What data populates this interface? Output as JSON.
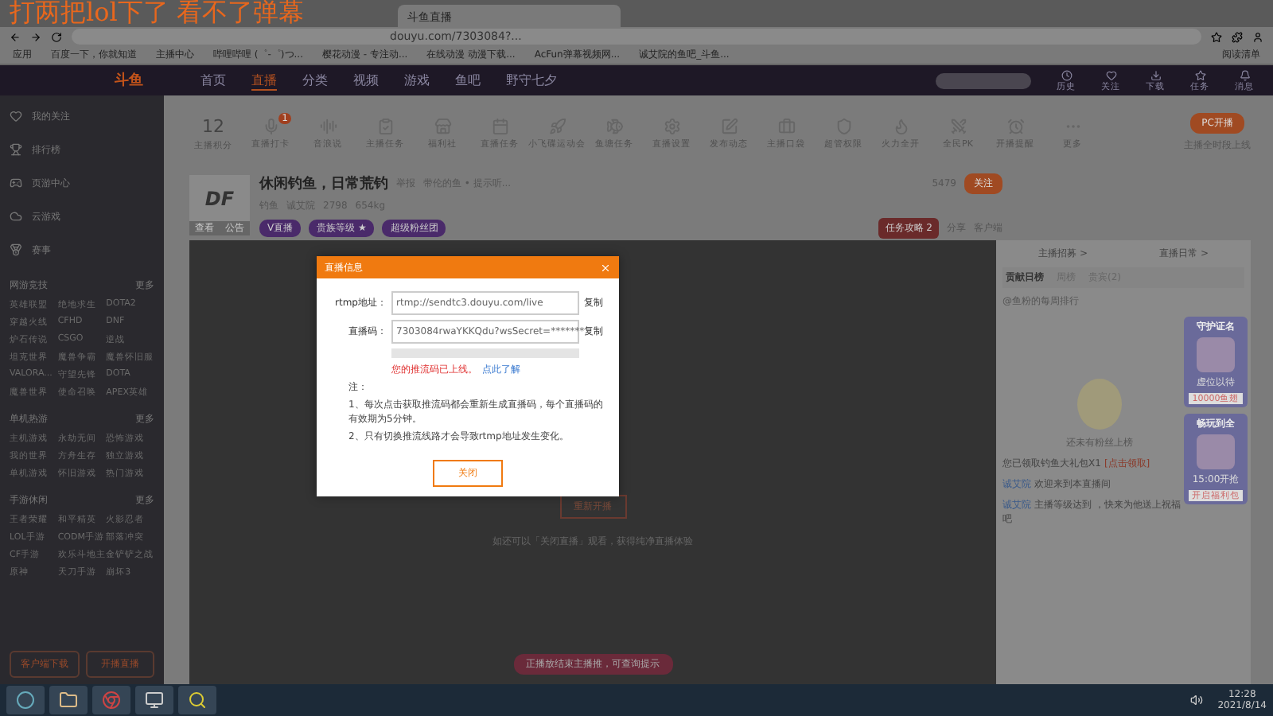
{
  "caption": "打两把lol下了 看不了弹幕",
  "browser": {
    "tab_title": "斗鱼直播",
    "url": "douyu.com/7303084?...",
    "bookmarks": [
      "应用",
      "百度一下，你就知道",
      "主播中心",
      "哔哩哔哩 (゜-゜)つ...",
      "樱花动漫 - 专注动...",
      "在线动漫 动漫下载...",
      "AcFun弹幕视频网...",
      "诚艾院的鱼吧_斗鱼..."
    ],
    "reading_list": "阅读清单"
  },
  "site_nav": {
    "logo": "斗鱼",
    "items": [
      {
        "label": "首页",
        "selected": false
      },
      {
        "label": "直播",
        "selected": true
      },
      {
        "label": "分类",
        "selected": false
      },
      {
        "label": "视频",
        "selected": false
      },
      {
        "label": "游戏",
        "selected": false
      },
      {
        "label": "鱼吧",
        "selected": false
      },
      {
        "label": "野守七夕",
        "selected": false
      }
    ],
    "actions": [
      "历史",
      "关注",
      "下载",
      "任务",
      "消息"
    ]
  },
  "sidebar": {
    "items": [
      "我的关注",
      "排行榜",
      "页游中心",
      "云游戏",
      "赛事"
    ],
    "sections": [
      {
        "title": "网游竞技",
        "more": "更多",
        "games": [
          "英雄联盟",
          "绝地求生",
          "DOTA2",
          "穿越火线",
          "CFHD",
          "DNF",
          "炉石传说",
          "CSGO",
          "逆战",
          "坦克世界",
          "魔兽争霸",
          "魔兽怀旧服",
          "VALORA...",
          "守望先锋",
          "DOTA",
          "魔兽世界",
          "使命召唤",
          "APEX英雄"
        ]
      },
      {
        "title": "单机热游",
        "more": "更多",
        "games": [
          "主机游戏",
          "永劫无间",
          "恐怖游戏",
          "我的世界",
          "方舟生存",
          "独立游戏",
          "单机游戏",
          "怀旧游戏",
          "热门游戏"
        ]
      },
      {
        "title": "手游休闲",
        "more": "更多",
        "games": [
          "王者荣耀",
          "和平精英",
          "火影忍者",
          "LOL手游",
          "CODM手游",
          "部落冲突",
          "CF手游",
          "欢乐斗地主",
          "金铲铲之战",
          "原神",
          "天刀手游",
          "崩坏3"
        ]
      }
    ],
    "buttons": [
      "客户端下载",
      "开播直播"
    ]
  },
  "toolbar": {
    "score": "12",
    "score_label": "主播积分",
    "items": [
      {
        "label": "直播打卡",
        "badge": "1"
      },
      {
        "label": "音浪说"
      },
      {
        "label": "主播任务"
      },
      {
        "label": "福利社"
      },
      {
        "label": "直播任务"
      },
      {
        "label": "小飞碟运动会"
      },
      {
        "label": "鱼塘任务"
      },
      {
        "label": "直播设置"
      },
      {
        "label": "发布动态"
      },
      {
        "label": "主播口袋"
      },
      {
        "label": "超管权限"
      },
      {
        "label": "火力全开"
      },
      {
        "label": "全民PK"
      },
      {
        "label": "开播提醒"
      },
      {
        "label": "更多"
      }
    ],
    "pc_button": "PC开播",
    "pc_note": "主播全时段上线"
  },
  "room": {
    "avatar": "DF",
    "avatar_links": [
      "查看",
      "公告"
    ],
    "title": "休闲钓鱼，日常荒钓",
    "report": "举报",
    "notice": "带伦的鱼 • 提示听...",
    "category": "钓鱼",
    "anchor": "诚艾院",
    "hot": "2798",
    "weight": "654kg",
    "tags": [
      "V直播",
      "贵族等级 ★",
      "超级粉丝团"
    ],
    "followers": "5479",
    "follow": "关注",
    "rank_button": "任务攻略 2",
    "share": "分享",
    "client": "客户端"
  },
  "dialog": {
    "title": "直播信息",
    "rtmp_label": "rtmp地址：",
    "rtmp_value": "rtmp://sendtc3.douyu.com/live",
    "code_label": "直播码：",
    "code_value": "7303084rwaYKKQdu?wsSecret=*******",
    "copy_rtmp": "复制",
    "copy_code": "复制",
    "warning": "您的推流码已上线。",
    "warning_link": "点此了解",
    "note_title": "注：",
    "notes": [
      "1、每次点击获取推流码都会重新生成直播码，每个直播码的有效期为5分钟。",
      "2、只有切换推流线路才会导致rtmp地址发生变化。"
    ],
    "close": "关闭"
  },
  "player": {
    "button": "重新开播",
    "hint": "如还可以「关闭直播」观看，获得纯净直播体验",
    "toast": "正播放结束主播推，可查询提示"
  },
  "right_panel": {
    "links": [
      "主播招募 >",
      "直播日常 >"
    ],
    "tabs": [
      {
        "label": "贡献日榜",
        "selected": true
      },
      {
        "label": "周榜",
        "selected": false
      },
      {
        "label": "贵宾(2)",
        "selected": false
      }
    ],
    "fan_row": "@鱼粉的每周排行",
    "empty": "还未有粉丝上榜",
    "chat": [
      {
        "text": "您已领取钓鱼大礼包X1",
        "extra": "[点击领取]"
      },
      {
        "user": "诚艾院",
        "text": "欢迎来到本直播间"
      },
      {
        "user": "诚艾院",
        "text": "主播等级达到 ，快来为他送上祝福吧"
      }
    ],
    "banners": [
      {
        "title": "守护证名",
        "caption": "虚位以待",
        "sub": "10000鱼翅"
      },
      {
        "title": "畅玩到全",
        "caption": "15:00开抢",
        "sub": "开启福利包"
      }
    ]
  },
  "taskbar": {
    "time": "12:28",
    "date": "2021/8/14"
  }
}
